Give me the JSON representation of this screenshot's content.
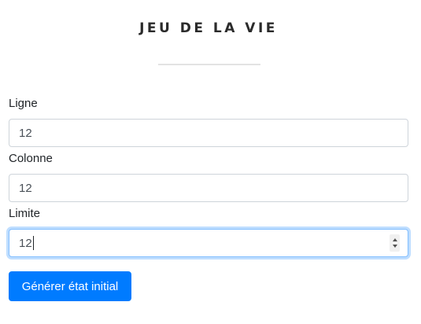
{
  "title": "JEU DE LA VIE",
  "form": {
    "ligne": {
      "label": "Ligne",
      "value": "12"
    },
    "colonne": {
      "label": "Colonne",
      "value": "12"
    },
    "limite": {
      "label": "Limite",
      "value": "12"
    }
  },
  "generate_button": "Générer état initial",
  "colors": {
    "primary": "#007bff",
    "focus_border": "#80bdff",
    "input_border": "#ced4da",
    "divider": "#e3e3e3"
  }
}
